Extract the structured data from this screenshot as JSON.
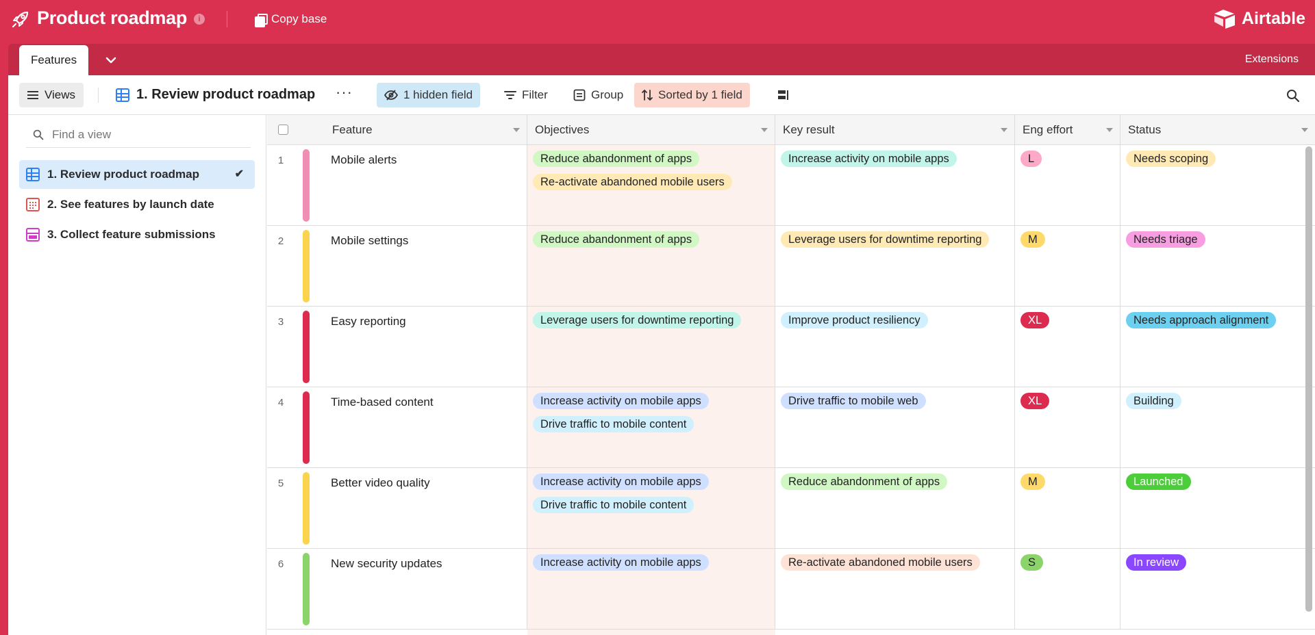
{
  "app": {
    "base_title": "Product roadmap",
    "info_glyph": "i",
    "copy_label": "Copy base",
    "brand": "Airtable"
  },
  "tabs": {
    "active_label": "Features",
    "extensions_label": "Extensions"
  },
  "toolbar": {
    "views_label": "Views",
    "view_title": "1. Review product roadmap",
    "more_glyph": "···",
    "hidden_field_label": "1 hidden field",
    "filter_label": "Filter",
    "group_label": "Group",
    "sorted_label": "Sorted by 1 field"
  },
  "sidebar": {
    "find_placeholder": "Find a view",
    "check_glyph": "✔",
    "items": [
      {
        "label": "1. Review product roadmap",
        "icon": "grid-view-icon",
        "active": true
      },
      {
        "label": "2. See features by launch date",
        "icon": "calendar-view-icon",
        "active": false
      },
      {
        "label": "3. Collect feature submissions",
        "icon": "form-view-icon",
        "active": false
      }
    ]
  },
  "grid": {
    "columns": [
      "Feature",
      "Objectives",
      "Key result",
      "Eng effort",
      "Status"
    ],
    "rows": [
      {
        "num": "1",
        "bar": "#f08fb3",
        "feature": "Mobile alerts",
        "objectives": [
          {
            "t": "Reduce abandonment of apps",
            "c": "#d1f7c4"
          },
          {
            "t": "Re-activate abandoned mobile users",
            "c": "#ffeab6"
          }
        ],
        "key_result": [
          {
            "t": "Increase activity on mobile apps",
            "c": "#c2f5e9"
          }
        ],
        "effort": {
          "t": "L",
          "c": "#ffa9c9",
          "fg": "#222"
        },
        "status": {
          "t": "Needs scoping",
          "c": "#ffeab6",
          "fg": "#222"
        }
      },
      {
        "num": "2",
        "bar": "#fcd34d",
        "feature": "Mobile settings",
        "objectives": [
          {
            "t": "Reduce abandonment of apps",
            "c": "#d1f7c4"
          }
        ],
        "key_result": [
          {
            "t": "Leverage users for downtime reporting",
            "c": "#ffeab6"
          }
        ],
        "effort": {
          "t": "M",
          "c": "#ffda6a",
          "fg": "#222"
        },
        "status": {
          "t": "Needs triage",
          "c": "#f99de2",
          "fg": "#222"
        }
      },
      {
        "num": "3",
        "bar": "#dc2b4f",
        "feature": "Easy reporting",
        "objectives": [
          {
            "t": "Leverage users for downtime reporting",
            "c": "#c2f5e9"
          }
        ],
        "key_result": [
          {
            "t": "Improve product resiliency",
            "c": "#d0f0fd"
          }
        ],
        "effort": {
          "t": "XL",
          "c": "#dc2b4f",
          "fg": "#ffffff"
        },
        "status": {
          "t": "Needs approach alignment",
          "c": "#6cd0f0",
          "fg": "#222"
        }
      },
      {
        "num": "4",
        "bar": "#dc2b4f",
        "feature": "Time-based content",
        "objectives": [
          {
            "t": "Increase activity on mobile apps",
            "c": "#cfdfff"
          },
          {
            "t": "Drive traffic to mobile content",
            "c": "#d0f0fd"
          }
        ],
        "key_result": [
          {
            "t": "Drive traffic to mobile web",
            "c": "#cfdfff"
          }
        ],
        "effort": {
          "t": "XL",
          "c": "#dc2b4f",
          "fg": "#ffffff"
        },
        "status": {
          "t": "Building",
          "c": "#d0f0fd",
          "fg": "#222"
        }
      },
      {
        "num": "5",
        "bar": "#fcd34d",
        "feature": "Better video quality",
        "objectives": [
          {
            "t": "Increase activity on mobile apps",
            "c": "#cfdfff"
          },
          {
            "t": "Drive traffic to mobile content",
            "c": "#d0f0fd"
          }
        ],
        "key_result": [
          {
            "t": "Reduce abandonment of apps",
            "c": "#d1f7c4"
          }
        ],
        "effort": {
          "t": "M",
          "c": "#ffda6a",
          "fg": "#222"
        },
        "status": {
          "t": "Launched",
          "c": "#4ccd3a",
          "fg": "#ffffff"
        }
      },
      {
        "num": "6",
        "bar": "#8bd46a",
        "feature": "New security updates",
        "objectives": [
          {
            "t": "Increase activity on mobile apps",
            "c": "#cfdfff"
          }
        ],
        "key_result": [
          {
            "t": "Re-activate abandoned mobile users",
            "c": "#fee2d5"
          }
        ],
        "effort": {
          "t": "S",
          "c": "#8bd46a",
          "fg": "#222"
        },
        "status": {
          "t": "In review",
          "c": "#8b46ff",
          "fg": "#ffffff"
        }
      }
    ]
  },
  "colors": {
    "brand_red": "#d9314f",
    "tab_bar": "#c22a45",
    "objectives_highlight": "#fdf1ee"
  }
}
